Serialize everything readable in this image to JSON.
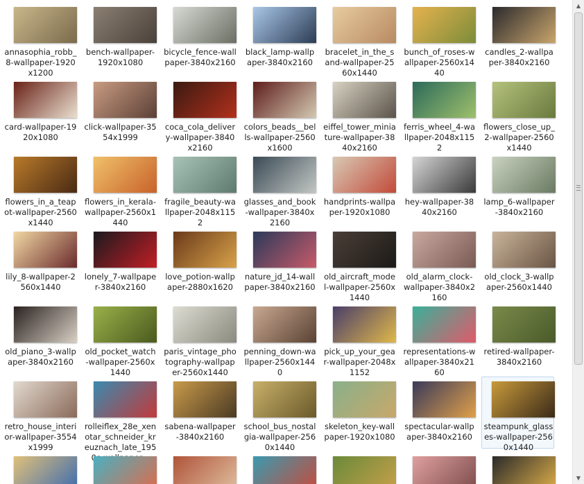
{
  "scrollbar": {
    "up_arrow": "▲",
    "down_arrow": "▼"
  },
  "selected_file": "steampunk_glasses-wallpaper-2560x1440",
  "files": [
    {
      "name": "annasophia_robb_8-wallpaper-1920x1200",
      "icon": "image-thumbnail-icon",
      "colors": [
        "#c9b68a",
        "#7a6b4c"
      ]
    },
    {
      "name": "bench-wallpaper-1920x1080",
      "icon": "image-thumbnail-icon",
      "colors": [
        "#8b7f72",
        "#4a413a"
      ]
    },
    {
      "name": "bicycle_fence-wallpaper-3840x2160",
      "icon": "image-thumbnail-icon",
      "colors": [
        "#d7d9d4",
        "#6b6f63"
      ]
    },
    {
      "name": "black_lamp-wallpaper-3840x2160",
      "icon": "image-thumbnail-icon",
      "colors": [
        "#a9c7e8",
        "#2c3c54"
      ]
    },
    {
      "name": "bracelet_in_the_sand-wallpaper-2560x1440",
      "icon": "image-thumbnail-icon",
      "colors": [
        "#e8cba0",
        "#b88a62"
      ]
    },
    {
      "name": "bunch_of_roses-wallpaper-2560x1440",
      "icon": "image-thumbnail-icon",
      "colors": [
        "#e6b24e",
        "#7c8c3a"
      ]
    },
    {
      "name": "candles_2-wallpaper-3840x2160",
      "icon": "image-thumbnail-icon",
      "colors": [
        "#2b2a2e",
        "#c9a56b"
      ]
    },
    {
      "name": "card-wallpaper-1920x1080",
      "icon": "image-thumbnail-icon",
      "colors": [
        "#6a2218",
        "#e9e0d0"
      ]
    },
    {
      "name": "click-wallpaper-3554x1999",
      "icon": "image-thumbnail-icon",
      "colors": [
        "#c99b82",
        "#5b4036"
      ]
    },
    {
      "name": "coca_cola_delivery-wallpaper-3840x2160",
      "icon": "image-thumbnail-icon",
      "colors": [
        "#3a1a12",
        "#b2301c"
      ]
    },
    {
      "name": "colors_beads__bells-wallpaper-2560x1600",
      "icon": "image-thumbnail-icon",
      "colors": [
        "#5e1d1c",
        "#d4c9b2"
      ]
    },
    {
      "name": "eiffel_tower_miniature-wallpaper-3840x2160",
      "icon": "image-thumbnail-icon",
      "colors": [
        "#d7d2c2",
        "#5b534a"
      ]
    },
    {
      "name": "ferris_wheel_4-wallpaper-2048x1152",
      "icon": "image-thumbnail-icon",
      "colors": [
        "#2b6a5a",
        "#9fc06c"
      ]
    },
    {
      "name": "flowers_close_up_2-wallpaper-2560x1440",
      "icon": "image-thumbnail-icon",
      "colors": [
        "#b4c27c",
        "#6a7a3e"
      ]
    },
    {
      "name": "flowers_in_a_teapot-wallpaper-2560x1440",
      "icon": "image-thumbnail-icon",
      "colors": [
        "#b87a2a",
        "#4a2a14"
      ]
    },
    {
      "name": "flowers_in_kerala-wallpaper-2560x1440",
      "icon": "image-thumbnail-icon",
      "colors": [
        "#f0c16a",
        "#c8622a"
      ]
    },
    {
      "name": "fragile_beauty-wallpaper-2048x1152",
      "icon": "image-thumbnail-icon",
      "colors": [
        "#a8c2b6",
        "#5e7a6e"
      ]
    },
    {
      "name": "glasses_and_book-wallpaper-3840x2160",
      "icon": "image-thumbnail-icon",
      "colors": [
        "#3a4a56",
        "#c3c7c4"
      ]
    },
    {
      "name": "handprints-wallpaper-1920x1080",
      "icon": "image-thumbnail-icon",
      "colors": [
        "#d8c9b4",
        "#c24a3a"
      ]
    },
    {
      "name": "hey-wallpaper-3840x2160",
      "icon": "image-thumbnail-icon",
      "colors": [
        "#d5d5d5",
        "#3a3a3a"
      ]
    },
    {
      "name": "lamp_6-wallpaper-3840x2160",
      "icon": "image-thumbnail-icon",
      "colors": [
        "#c9d2c0",
        "#6a7a62"
      ]
    },
    {
      "name": "lily_8-wallpaper-2560x1440",
      "icon": "image-thumbnail-icon",
      "colors": [
        "#f1d8a4",
        "#6a2a2c"
      ]
    },
    {
      "name": "lonely_7-wallpaper-3840x2160",
      "icon": "image-thumbnail-icon",
      "colors": [
        "#1a1a1e",
        "#c21e26"
      ]
    },
    {
      "name": "love_potion-wallpaper-2880x1620",
      "icon": "image-thumbnail-icon",
      "colors": [
        "#6a3a1a",
        "#d8a24a"
      ]
    },
    {
      "name": "nature_jd_14-wallpaper-3840x2160",
      "icon": "image-thumbnail-icon",
      "colors": [
        "#2a3a5a",
        "#c85a6a"
      ]
    },
    {
      "name": "old_aircraft_model-wallpaper-2560x1440",
      "icon": "image-thumbnail-icon",
      "colors": [
        "#4a3e36",
        "#1c1a18"
      ]
    },
    {
      "name": "old_alarm_clock-wallpaper-3840x2160",
      "icon": "image-thumbnail-icon",
      "colors": [
        "#c9a8a0",
        "#7a5a54"
      ]
    },
    {
      "name": "old_clock_3-wallpaper-2560x1440",
      "icon": "image-thumbnail-icon",
      "colors": [
        "#c9b49a",
        "#6a5444"
      ]
    },
    {
      "name": "old_piano_3-wallpaper-3840x2160",
      "icon": "image-thumbnail-icon",
      "colors": [
        "#2a2220",
        "#d8d0c4"
      ]
    },
    {
      "name": "old_pocket_watch-wallpaper-2560x1440",
      "icon": "image-thumbnail-icon",
      "colors": [
        "#9ab04a",
        "#4a5a1e"
      ]
    },
    {
      "name": "paris_vintage_photography-wallpaper-2560x1440",
      "icon": "image-thumbnail-icon",
      "colors": [
        "#dcdcd2",
        "#8a8a7e"
      ]
    },
    {
      "name": "penning_down-wallpaper-2560x1440",
      "icon": "image-thumbnail-icon",
      "colors": [
        "#c8a890",
        "#5a4234"
      ]
    },
    {
      "name": "pick_up_your_gear-wallpaper-2048x1152",
      "icon": "image-thumbnail-icon",
      "colors": [
        "#4a3e6a",
        "#e0b84a"
      ]
    },
    {
      "name": "representations-wallpaper-3840x2160",
      "icon": "image-thumbnail-icon",
      "colors": [
        "#3ab09a",
        "#e05a6a"
      ]
    },
    {
      "name": "retired-wallpaper-3840x2160",
      "icon": "image-thumbnail-icon",
      "colors": [
        "#7a8a4a",
        "#4a5a2a"
      ]
    },
    {
      "name": "retro_house_interior-wallpaper-3554x1999",
      "icon": "image-thumbnail-icon",
      "colors": [
        "#e2d9ce",
        "#8a6a5a"
      ]
    },
    {
      "name": "rolleiflex_28e_xenotar_schneider_kreuznach_late_1950s-wallpaper...",
      "icon": "image-thumbnail-icon",
      "colors": [
        "#3a8ab0",
        "#c23a3a"
      ]
    },
    {
      "name": "sabena-wallpaper-3840x2160",
      "icon": "image-thumbnail-icon",
      "colors": [
        "#c99a4a",
        "#4a3a24"
      ]
    },
    {
      "name": "school_bus_nostalgia-wallpaper-2560x1440",
      "icon": "image-thumbnail-icon",
      "colors": [
        "#c8b06a",
        "#6a5a2a"
      ]
    },
    {
      "name": "skeleton_key-wallpaper-1920x1080",
      "icon": "image-thumbnail-icon",
      "colors": [
        "#8ab08a",
        "#c8a86a"
      ]
    },
    {
      "name": "spectacular-wallpaper-3840x2160",
      "icon": "image-thumbnail-icon",
      "colors": [
        "#3a3a5a",
        "#e0a04a"
      ]
    },
    {
      "name": "steampunk_glasses-wallpaper-2560x1440",
      "icon": "image-thumbnail-icon",
      "colors": [
        "#c89a3a",
        "#3a2a1a"
      ]
    },
    {
      "name": "",
      "icon": "image-thumbnail-icon",
      "colors": [
        "#e0c07a",
        "#3a6ab0"
      ]
    },
    {
      "name": "",
      "icon": "image-thumbnail-icon",
      "colors": [
        "#4ab0c0",
        "#e06a4a"
      ]
    },
    {
      "name": "",
      "icon": "image-thumbnail-icon",
      "colors": [
        "#b0543a",
        "#e0c0a0"
      ]
    },
    {
      "name": "",
      "icon": "image-thumbnail-icon",
      "colors": [
        "#3a9ab0",
        "#c84a3a"
      ]
    },
    {
      "name": "",
      "icon": "image-thumbnail-icon",
      "colors": [
        "#6a8a3a",
        "#c8a04a"
      ]
    },
    {
      "name": "",
      "icon": "image-thumbnail-icon",
      "colors": [
        "#e0a0a0",
        "#7a4a4a"
      ]
    },
    {
      "name": "",
      "icon": "image-thumbnail-icon",
      "colors": [
        "#2a2a2a",
        "#e0b04a"
      ]
    }
  ]
}
